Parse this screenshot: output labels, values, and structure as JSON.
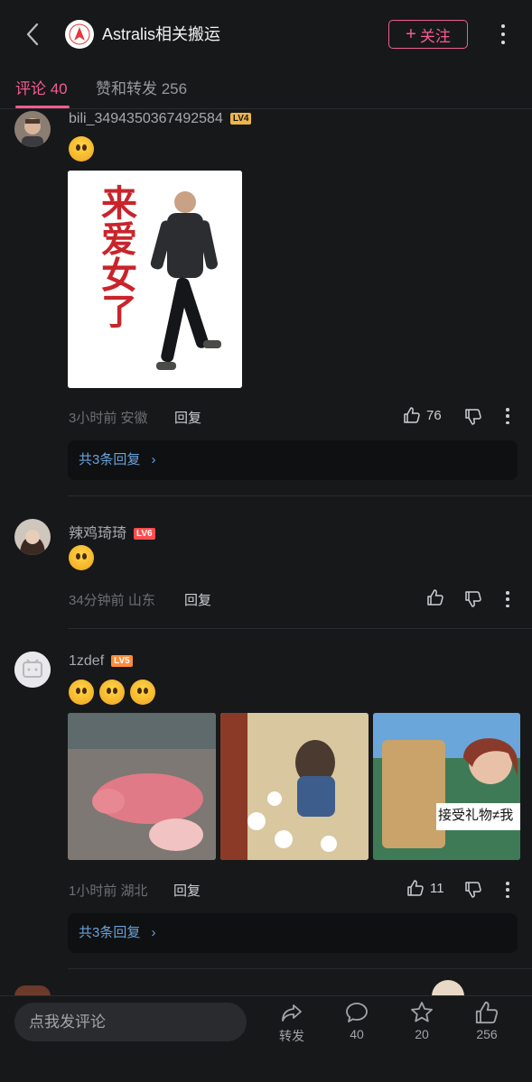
{
  "header": {
    "title": "Astralis相关搬运",
    "follow_label": "关注",
    "follow_plus": "+"
  },
  "tabs": [
    {
      "label": "评论 40",
      "active": true
    },
    {
      "label": "赞和转发 256",
      "active": false
    }
  ],
  "comments": [
    {
      "username": "bili_3494350367492584",
      "level": "LV4",
      "emojis": 1,
      "image_text": "来爱女了",
      "meta": "3小时前 安徽",
      "reply_label": "回复",
      "likes": "76",
      "replies_summary": "共3条回复"
    },
    {
      "username": "辣鸡琦琦",
      "level": "LV6",
      "emojis": 1,
      "meta": "34分钟前 山东",
      "reply_label": "回复",
      "likes": ""
    },
    {
      "username": "1zdef",
      "level": "LV5",
      "emojis": 3,
      "image_caption": "接受礼物≠我",
      "meta": "1小时前 湖北",
      "reply_label": "回复",
      "likes": "11",
      "replies_summary": "共3条回复"
    }
  ],
  "bottom": {
    "input_placeholder": "点我发评论",
    "actions": [
      {
        "icon": "share-icon",
        "label": "转发"
      },
      {
        "icon": "comment-icon",
        "label": "40"
      },
      {
        "icon": "star-icon",
        "label": "20"
      },
      {
        "icon": "thumbs-up-icon",
        "label": "256"
      }
    ]
  },
  "colors": {
    "background": "#17181a",
    "accent": "#f25d8e",
    "link": "#6aa2db",
    "lv4": "#f0b54a",
    "lv5": "#ff8c3a",
    "lv6": "#ff4d4d"
  }
}
